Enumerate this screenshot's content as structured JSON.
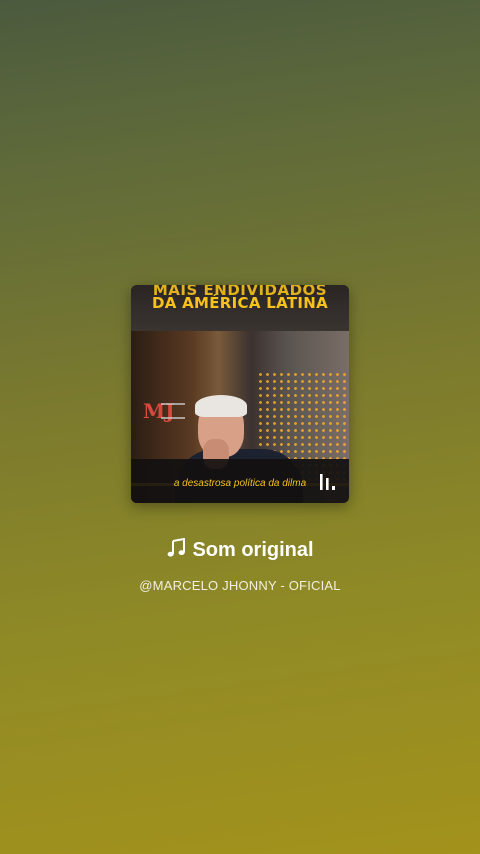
{
  "album_cover": {
    "headline_line1": "MAIS ENDIVIDADOS",
    "headline_line2": "DA AMÉRICA LATINA",
    "logo_text": "MJ",
    "caption": "a desastrosa política da dilma",
    "icon": "equalizer-bars-icon"
  },
  "sound": {
    "note_icon": "music-note-icon",
    "title": "Som original",
    "author": "@MARCELO JHONNY - OFICIAL"
  },
  "colors": {
    "accent_yellow": "#f6c21b",
    "title_text": "#ffffff"
  }
}
